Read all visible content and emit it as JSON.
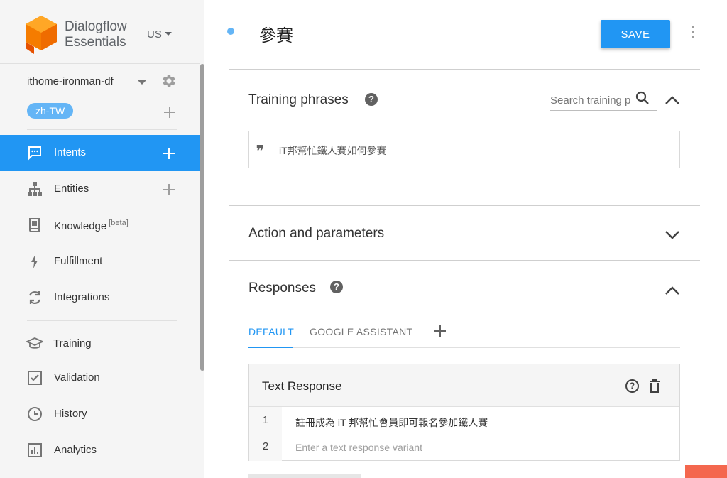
{
  "brand": {
    "line1": "Dialogflow",
    "line2": "Essentials",
    "region": "US"
  },
  "agent": {
    "name": "ithome-ironman-df",
    "language": "zh-TW"
  },
  "sidebar": {
    "items": [
      {
        "label": "Intents",
        "icon": "chat-icon",
        "active": true
      },
      {
        "label": "Entities",
        "icon": "hierarchy-icon"
      },
      {
        "label": "Knowledge",
        "badge": "[beta]",
        "icon": "book-icon"
      },
      {
        "label": "Fulfillment",
        "icon": "bolt-icon"
      },
      {
        "label": "Integrations",
        "icon": "sync-icon"
      },
      {
        "label": "Training",
        "icon": "graduation-cap-icon"
      },
      {
        "label": "Validation",
        "icon": "check-box-icon"
      },
      {
        "label": "History",
        "icon": "clock-icon"
      },
      {
        "label": "Analytics",
        "icon": "bar-chart-icon"
      }
    ]
  },
  "header": {
    "intent_name": "參賽",
    "save_label": "SAVE"
  },
  "training": {
    "title": "Training phrases",
    "search_placeholder": "Search training phrases",
    "phrases": [
      "iT邦幫忙鐵人賽如何參賽"
    ]
  },
  "action": {
    "title": "Action and parameters"
  },
  "responses": {
    "title": "Responses",
    "tabs": [
      "DEFAULT",
      "GOOGLE ASSISTANT"
    ],
    "card_title": "Text Response",
    "rows": [
      {
        "num": "1",
        "text": "註冊成為 iT 邦幫忙會員即可報名參加鐵人賽"
      },
      {
        "num": "2",
        "placeholder": "Enter a text response variant"
      }
    ]
  },
  "colors": {
    "accent": "#2196f3",
    "chip": "#64b5f6",
    "logo": "#ef6c00"
  }
}
